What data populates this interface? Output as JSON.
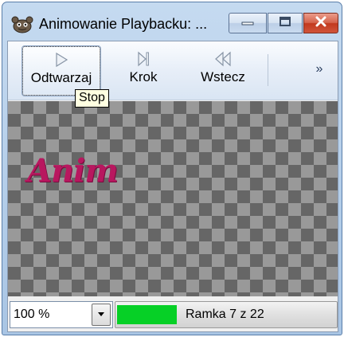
{
  "window": {
    "title": "Animowanie Playbacku: ..."
  },
  "toolbar": {
    "play_label": "Odtwarzaj",
    "step_label": "Krok",
    "back_label": "Wstecz",
    "more_label": "»"
  },
  "tooltip": {
    "text": "Stop"
  },
  "preview": {
    "frame_text": "Anim"
  },
  "status": {
    "zoom_value": "100 %",
    "frame_label": "Ramka 7 z 22",
    "progress_fraction": 0.27,
    "progress_color": "#06d026"
  },
  "colors": {
    "text_accent": "#b8175f",
    "close_button": "#c2391e"
  },
  "icons": {
    "app": "gimp-icon",
    "play": "play-icon",
    "step": "step-forward-icon",
    "back": "step-back-icon",
    "minimize": "minimize-icon",
    "maximize": "maximize-icon",
    "close": "close-icon",
    "dropdown": "chevron-down-icon"
  }
}
